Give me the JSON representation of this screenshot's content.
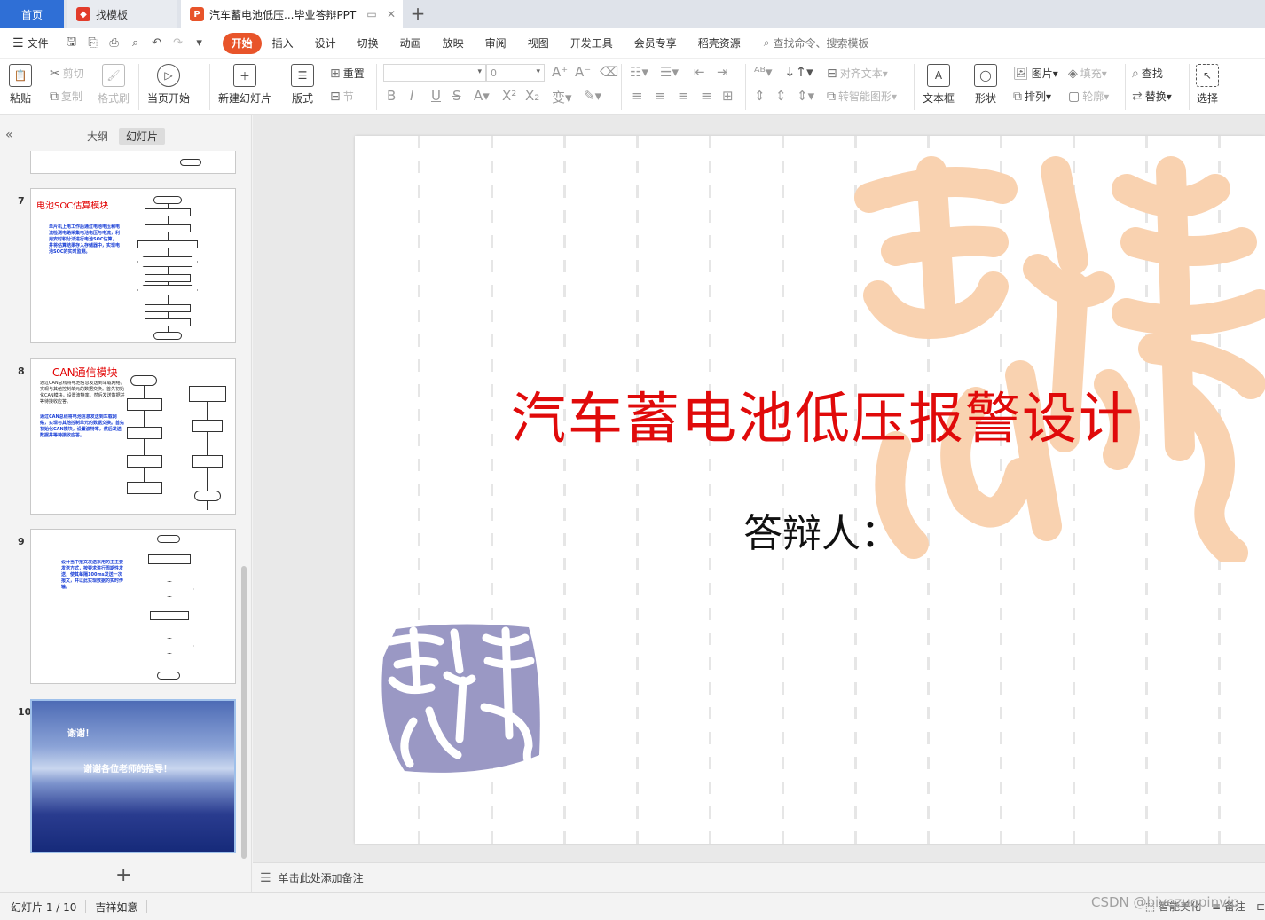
{
  "tabs": {
    "home": "首页",
    "template": "找模板",
    "document": "汽车蓄电池低压...毕业答辩PPT",
    "new_tab": "+"
  },
  "menu": {
    "file": "文件",
    "tabs": [
      "开始",
      "插入",
      "设计",
      "切换",
      "动画",
      "放映",
      "审阅",
      "视图",
      "开发工具",
      "会员专享",
      "稻壳资源"
    ],
    "search": "查找命令、搜索模板"
  },
  "ribbon": {
    "paste": "粘贴",
    "cut": "剪切",
    "copy": "复制",
    "format_painter": "格式刷",
    "start_from_current": "当页开始",
    "new_slide": "新建幻灯片",
    "layout": "版式",
    "reset": "重置",
    "section": "节",
    "font_size_value": "0",
    "align_text": "对齐文本",
    "smartart": "转智能图形",
    "textbox": "文本框",
    "shapes": "形状",
    "picture": "图片",
    "arrange": "排列",
    "fill": "填充",
    "outline": "轮廓",
    "find": "查找",
    "replace": "替换",
    "select": "选择"
  },
  "panel": {
    "outline_tab": "大纲",
    "slides_tab": "幻灯片",
    "add_slide": "+"
  },
  "thumbnails": [
    {
      "num": "7",
      "title": "电池SOC估算模块",
      "body": "单片机上电工作后通过电池电压和电流检测电路采集电池电压与电流，利用安时积分法进行电池SOC估算，并将估算结果存入存储器中，实现电池SOC的实时监测。"
    },
    {
      "num": "8",
      "title": "CAN通信模块",
      "body": "通过CAN总线将电池信息发送到车载网络，实现与其他控制单元的数据交换。首先初始化CAN模块，设置波特率，然后发送数据并等待接收应答。"
    },
    {
      "num": "9",
      "title": "",
      "body": "设计当中报文发送采用的主主要发送方式，按要求进行周期性发送，使其每隔100ms发送一次报文，并以此实现数据的实时传输。"
    },
    {
      "num": "10",
      "title": "谢谢！",
      "body": "谢谢各位老师的指导！"
    }
  ],
  "slide": {
    "title": "汽车蓄电池低压报警设计",
    "subtitle": "答辩人："
  },
  "notes": {
    "placeholder": "单击此处添加备注"
  },
  "status": {
    "slide_counter": "幻灯片 1 / 10",
    "theme": "吉祥如意",
    "smart_beautify": "智能美化",
    "notes_btn": "备注"
  },
  "watermark": "CSDN @biyezuopinvip",
  "colors": {
    "accent": "#e8542a",
    "home_tab": "#2f6fd6",
    "title_red": "#e00a0a",
    "seal_orange": "#f9d2b0",
    "seal_purple": "#9a98c4"
  }
}
